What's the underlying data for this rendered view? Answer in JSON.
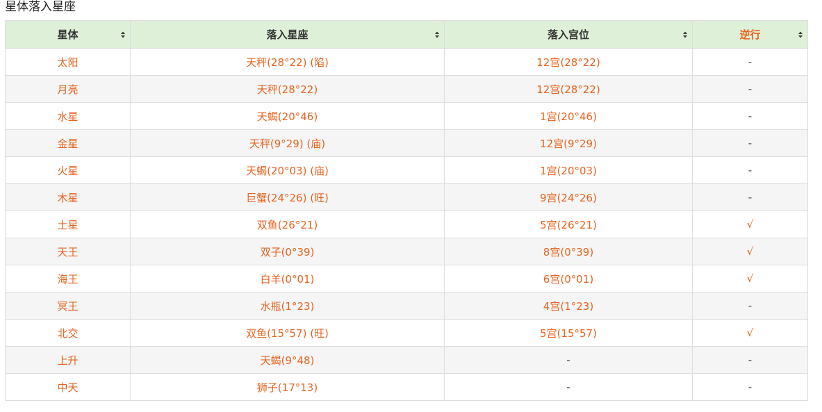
{
  "caption": "星体落入星座",
  "table": {
    "headers": [
      "星体",
      "落入星座",
      "落入宫位",
      "逆行"
    ],
    "rows": [
      {
        "planet": "太阳",
        "sign": "天秤(28°22) (陷)",
        "house": "12宫(28°22)",
        "retro": "-"
      },
      {
        "planet": "月亮",
        "sign": "天秤(28°22)",
        "house": "12宫(28°22)",
        "retro": "-"
      },
      {
        "planet": "水星",
        "sign": "天蝎(20°46)",
        "house": "1宫(20°46)",
        "retro": "-"
      },
      {
        "planet": "金星",
        "sign": "天秤(9°29) (庙)",
        "house": "12宫(9°29)",
        "retro": "-"
      },
      {
        "planet": "火星",
        "sign": "天蝎(20°03) (庙)",
        "house": "1宫(20°03)",
        "retro": "-"
      },
      {
        "planet": "木星",
        "sign": "巨蟹(24°26) (旺)",
        "house": "9宫(24°26)",
        "retro": "-"
      },
      {
        "planet": "土星",
        "sign": "双鱼(26°21)",
        "house": "5宫(26°21)",
        "retro": "√"
      },
      {
        "planet": "天王",
        "sign": "双子(0°39)",
        "house": "8宫(0°39)",
        "retro": "√"
      },
      {
        "planet": "海王",
        "sign": "白羊(0°01)",
        "house": "6宫(0°01)",
        "retro": "√"
      },
      {
        "planet": "冥王",
        "sign": "水瓶(1°23)",
        "house": "4宫(1°23)",
        "retro": "-"
      },
      {
        "planet": "北交",
        "sign": "双鱼(15°57) (旺)",
        "house": "5宫(15°57)",
        "retro": "√"
      },
      {
        "planet": "上升",
        "sign": "天蝎(9°48)",
        "house": "-",
        "retro": "-"
      },
      {
        "planet": "中天",
        "sign": "狮子(17°13)",
        "house": "-",
        "retro": "-"
      }
    ]
  },
  "colors": {
    "header_bg": "#dff0d8",
    "accent": "#e8631f",
    "stripe": "#f5f5f5",
    "border": "#dddddd"
  }
}
